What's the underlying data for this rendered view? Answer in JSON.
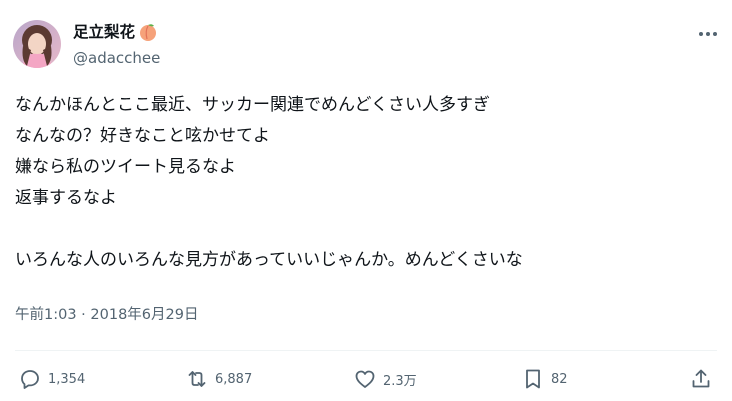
{
  "author": {
    "display_name": "足立梨花",
    "handle": "@adacchee"
  },
  "tweet": {
    "lines": [
      "なんかほんとここ最近、サッカー関連でめんどくさい人多すぎ",
      "なんなの？好きなこと呟かせてよ",
      "嫌なら私のツイート見るなよ",
      "返事するなよ",
      "",
      "いろんな人のいろんな見方があっていいじゃんか。めんどくさいな"
    ],
    "timestamp": "午前1:03 · 2018年6月29日"
  },
  "actions": {
    "replies": "1,354",
    "retweets": "6,887",
    "likes": "2.3万",
    "bookmarks": "82"
  },
  "icons": {
    "more": "more-horizontal-icon",
    "reply": "reply-icon",
    "retweet": "retweet-icon",
    "like": "heart-icon",
    "bookmark": "bookmark-icon",
    "share": "share-icon",
    "emoji": "peach-emoji-icon"
  },
  "colors": {
    "text_primary": "#0f1419",
    "text_secondary": "#536471",
    "divider": "#eff3f4",
    "peach": "#f6a27a"
  }
}
